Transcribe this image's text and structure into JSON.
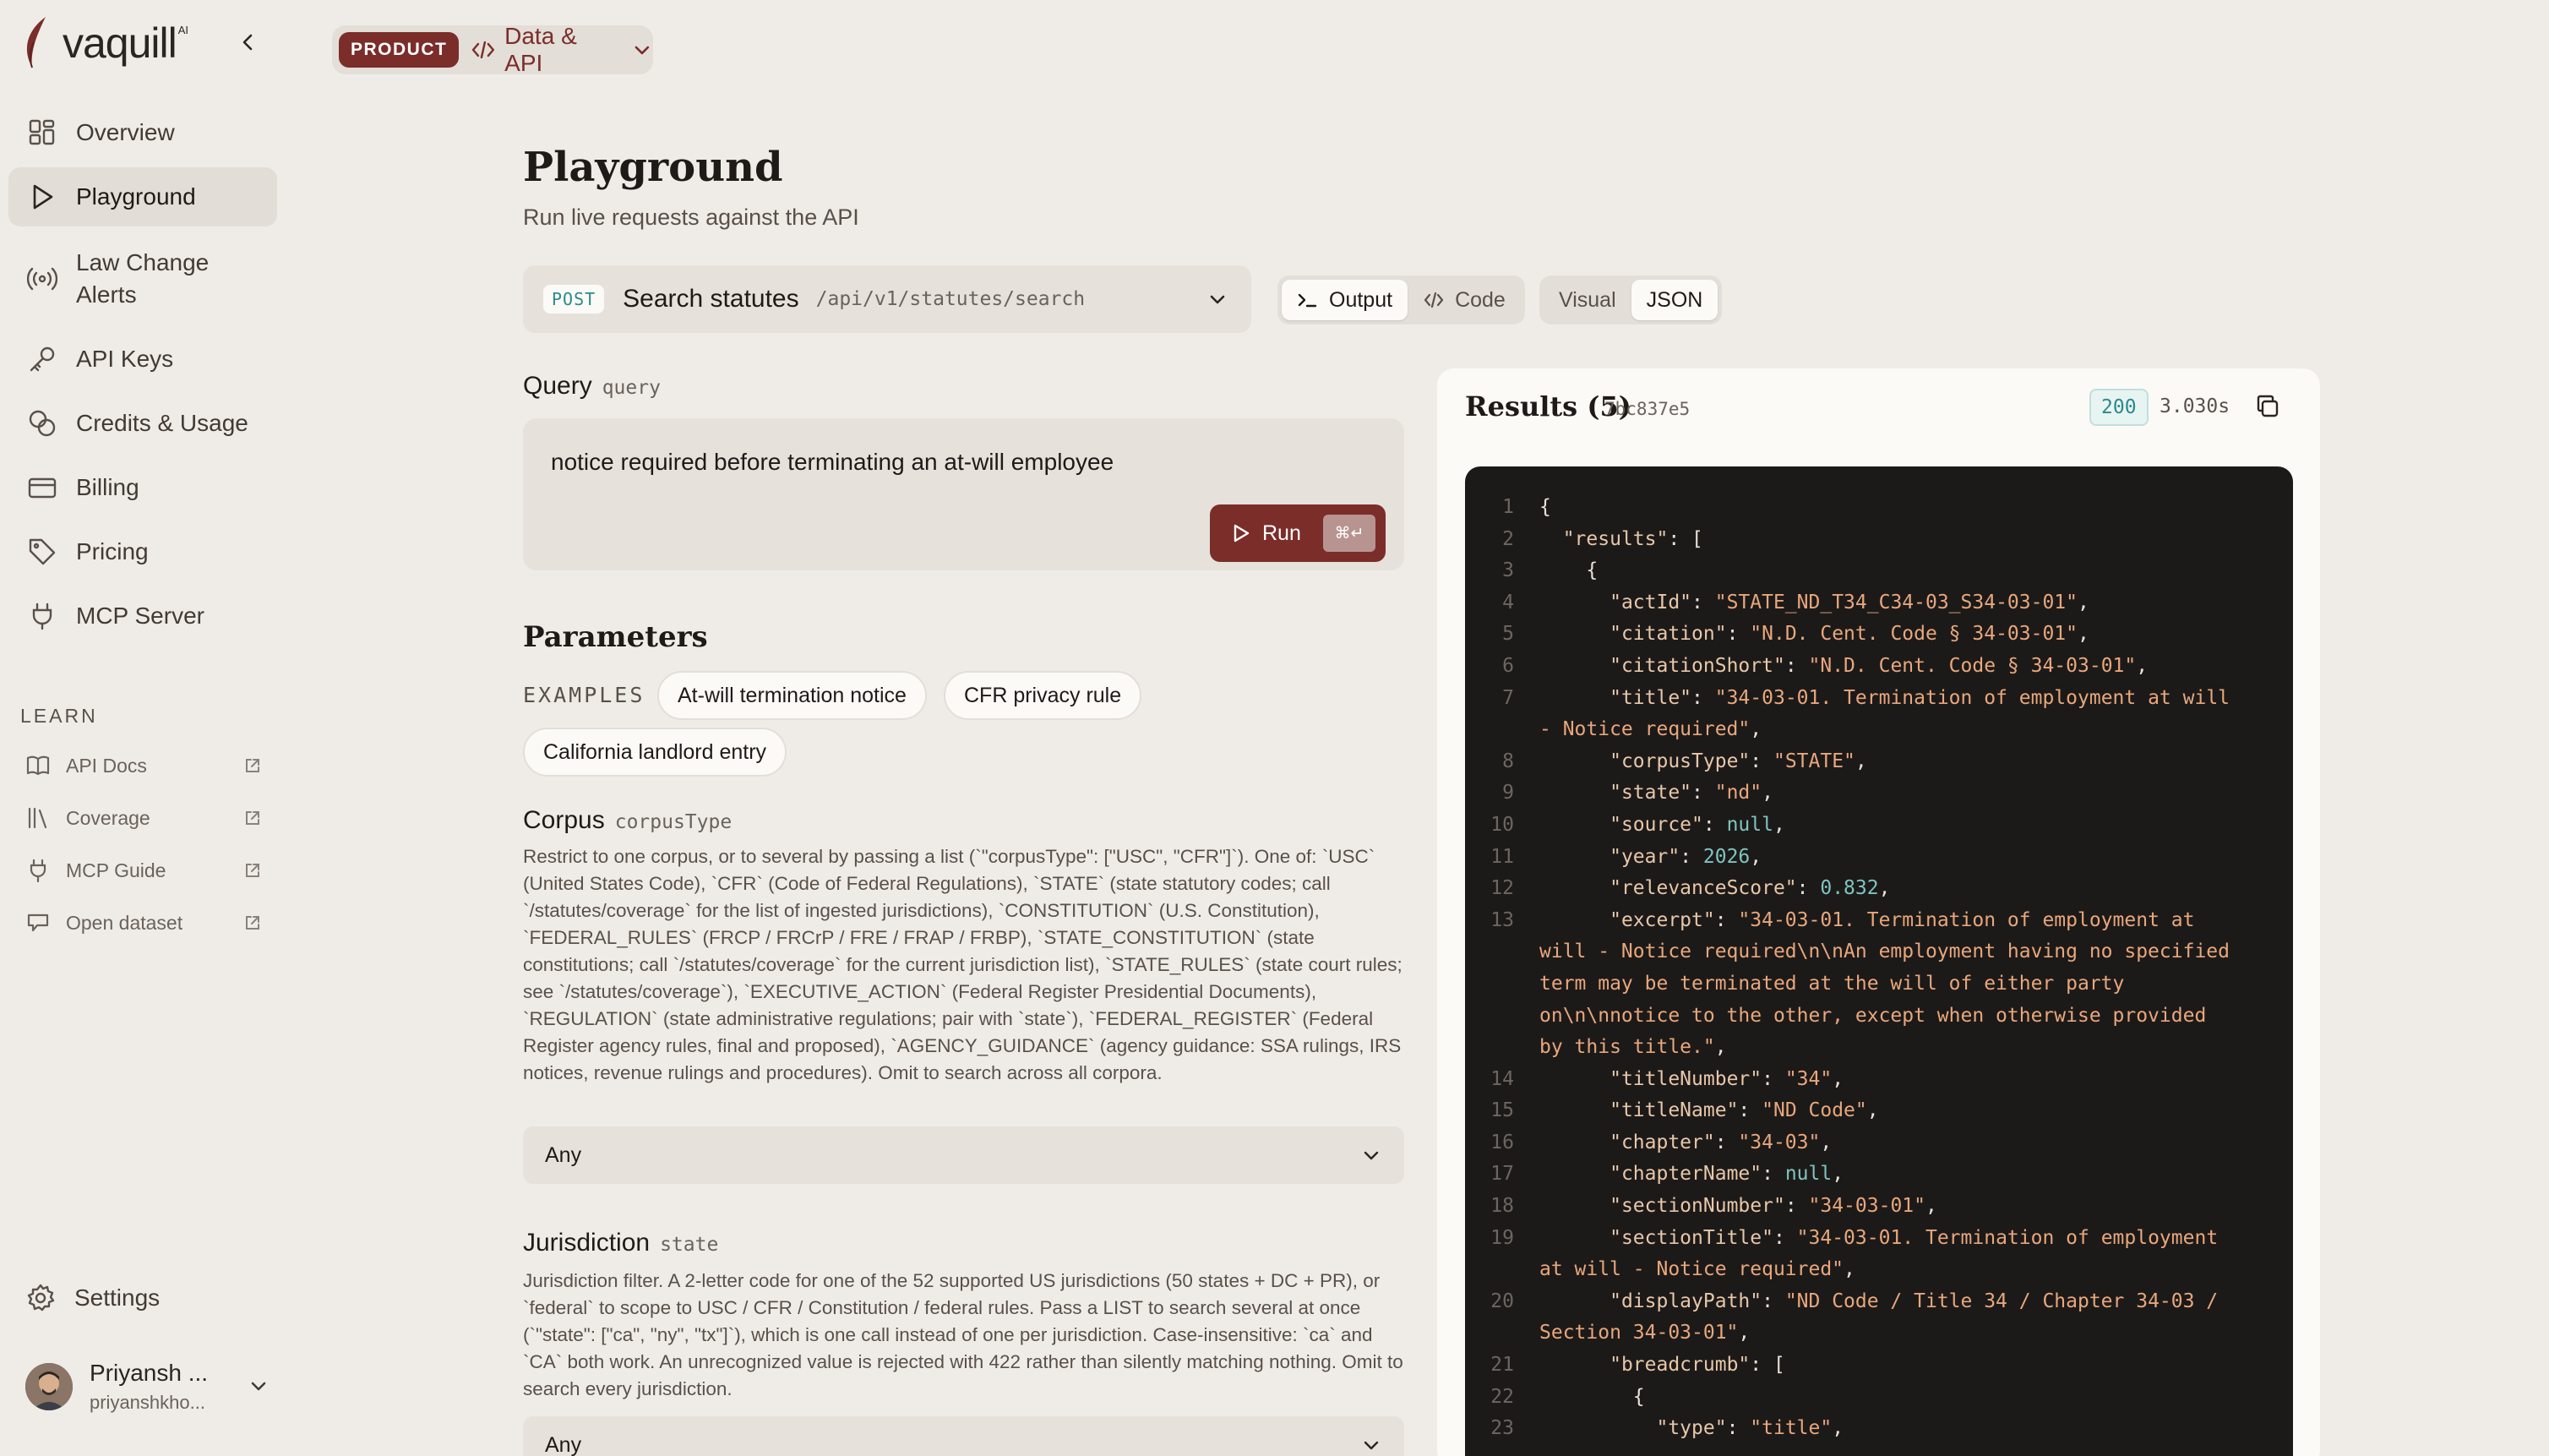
{
  "brand": {
    "name": "vaquill",
    "sup": "AI"
  },
  "nav": {
    "items": [
      {
        "label": "Overview",
        "icon": "grid-icon"
      },
      {
        "label": "Playground",
        "icon": "play-icon",
        "active": true
      },
      {
        "label": "Law Change Alerts",
        "icon": "broadcast-icon"
      },
      {
        "label": "API Keys",
        "icon": "key-icon"
      },
      {
        "label": "Credits & Usage",
        "icon": "coins-icon"
      },
      {
        "label": "Billing",
        "icon": "card-icon"
      },
      {
        "label": "Pricing",
        "icon": "tag-icon"
      },
      {
        "label": "MCP Server",
        "icon": "plug-icon"
      }
    ],
    "learn_title": "LEARN",
    "learn": [
      {
        "label": "API Docs",
        "icon": "book-icon"
      },
      {
        "label": "Coverage",
        "icon": "library-icon"
      },
      {
        "label": "MCP Guide",
        "icon": "plug-icon"
      },
      {
        "label": "Open dataset",
        "icon": "database-icon"
      }
    ],
    "settings": "Settings",
    "user": {
      "name": "Priyansh ...",
      "email": "priyanshkho..."
    }
  },
  "breadcrumb": {
    "badge": "PRODUCT",
    "label": "Data & API"
  },
  "page": {
    "title": "Playground",
    "subtitle": "Run live requests against the API"
  },
  "endpoint": {
    "method": "POST",
    "name": "Search statutes",
    "path": "/api/v1/statutes/search"
  },
  "view_toggle": {
    "output": "Output",
    "code": "Code"
  },
  "format_toggle": {
    "visual": "Visual",
    "json": "JSON"
  },
  "query": {
    "label": "Query",
    "key": "query",
    "value": "notice required before terminating an at-will employee",
    "run": "Run",
    "shortcut": "⌘↵"
  },
  "parameters": {
    "title": "Parameters",
    "examples_label": "EXAMPLES",
    "examples": [
      "At-will termination notice",
      "CFR privacy rule",
      "California landlord entry"
    ],
    "corpus": {
      "label": "Corpus",
      "key": "corpusType",
      "description": "Restrict to one corpus, or to several by passing a list (`\"corpusType\": [\"USC\", \"CFR\"]`). One of: `USC` (United States Code), `CFR` (Code of Federal Regulations), `STATE` (state statutory codes; call `/statutes/coverage` for the list of ingested jurisdictions), `CONSTITUTION` (U.S. Constitution), `FEDERAL_RULES` (FRCP / FRCrP / FRE / FRAP / FRBP), `STATE_CONSTITUTION` (state constitutions; call `/statutes/coverage` for the current jurisdiction list), `STATE_RULES` (state court rules; see `/statutes/coverage`), `EXECUTIVE_ACTION` (Federal Register Presidential Documents), `REGULATION` (state administrative regulations; pair with `state`), `FEDERAL_REGISTER` (Federal Register agency rules, final and proposed), `AGENCY_GUIDANCE` (agency guidance: SSA rulings, IRS notices, revenue rulings and procedures). Omit to search across all corpora.",
      "value": "Any"
    },
    "jurisdiction": {
      "label": "Jurisdiction",
      "key": "state",
      "description": "Jurisdiction filter. A 2-letter code for one of the 52 supported US jurisdictions (50 states + DC + PR), or `federal` to scope to USC / CFR / Constitution / federal rules. Pass a LIST to search several at once (`\"state\": [\"ca\", \"ny\", \"tx\"]`), which is one call instead of one per jurisdiction. Case-insensitive: `ca` and `CA` both work. An unrecognized value is rejected with 422 rather than silently matching nothing. Omit to search every jurisdiction.",
      "value": "Any"
    }
  },
  "results": {
    "title": "Results (5)",
    "request_id": "7bc837e5",
    "status": "200",
    "time": "3.030s"
  },
  "colors": {
    "accent": "#7b2d2a",
    "teal": "#2a8a8a",
    "bg": "#efece7",
    "code_bg": "#1c1a19"
  }
}
